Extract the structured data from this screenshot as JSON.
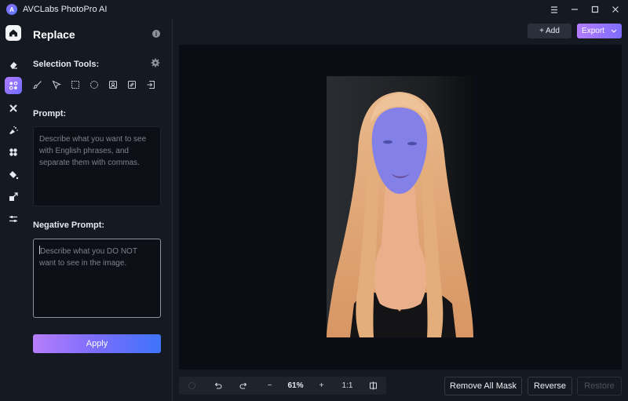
{
  "app": {
    "title": "AVCLabs PhotoPro AI",
    "logo_glyph": "A"
  },
  "window_controls": {
    "menu_icon": "hamburger-icon",
    "minimize_icon": "minimize-icon",
    "maximize_icon": "maximize-icon",
    "close_icon": "close-icon"
  },
  "rail": {
    "items": [
      {
        "name": "home",
        "icon": "home-icon"
      },
      {
        "name": "eraser",
        "icon": "eraser-icon"
      },
      {
        "name": "replace",
        "icon": "replace-icon",
        "active": true
      },
      {
        "name": "enhance",
        "icon": "enhance-icon"
      },
      {
        "name": "colorize",
        "icon": "colorize-icon"
      },
      {
        "name": "effects",
        "icon": "effects-icon"
      },
      {
        "name": "fill",
        "icon": "paint-bucket-icon"
      },
      {
        "name": "upscale",
        "icon": "expand-icon"
      },
      {
        "name": "adjust",
        "icon": "adjust-sliders-icon"
      }
    ]
  },
  "panel": {
    "title": "Replace",
    "info_icon": "i",
    "selection_tools_label": "Selection Tools:",
    "tools": [
      {
        "name": "brush",
        "icon": "brush-icon"
      },
      {
        "name": "lasso",
        "icon": "pointer-lasso-icon"
      },
      {
        "name": "rectangle",
        "icon": "rect-select-icon"
      },
      {
        "name": "ellipse",
        "icon": "ellipse-select-icon"
      },
      {
        "name": "portrait",
        "icon": "portrait-select-icon"
      },
      {
        "name": "background",
        "icon": "background-select-icon"
      },
      {
        "name": "import",
        "icon": "import-mask-icon"
      }
    ],
    "prompt_label": "Prompt:",
    "prompt_value": "",
    "prompt_placeholder": "Describe what you want to see with English phrases, and separate them with commas.",
    "negative_prompt_label": "Negative Prompt:",
    "negative_prompt_value": "",
    "negative_prompt_placeholder": "Describe what you DO NOT want to see in the image.",
    "apply_label": "Apply"
  },
  "header": {
    "add_label": "+ Add",
    "export_label": "Export"
  },
  "toolbar": {
    "zoom": "61%",
    "one_to_one": "1:1",
    "minus": "−",
    "plus": "+"
  },
  "actions": {
    "remove_all_mask": "Remove All Mask",
    "reverse": "Reverse",
    "restore": "Restore"
  },
  "colors": {
    "accent_start": "#b77dfd",
    "accent_end": "#3e74fb",
    "mask_overlay": "#7b7cf0"
  }
}
